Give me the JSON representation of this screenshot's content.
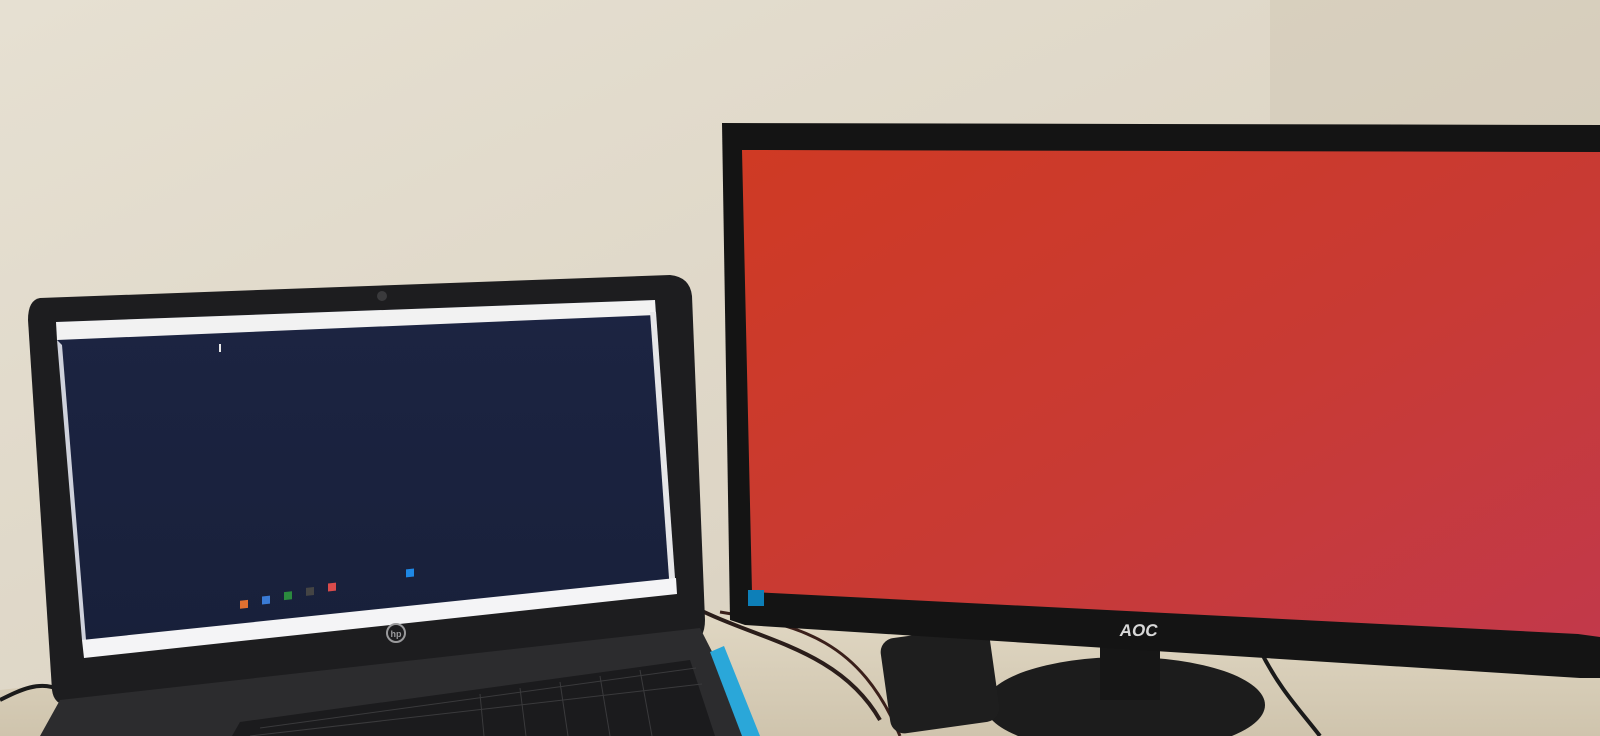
{
  "scene": {
    "wall_color": "#e3dccf",
    "desk_color": "#dcd2bd"
  },
  "laptop": {
    "brand_logo": "hp",
    "screen_background": "#1b2340",
    "window_title_bar": "#f2f2f2",
    "taskbar_color": "#f4f4f6",
    "icons": [
      "webcam-icon",
      "hp-logo-icon"
    ]
  },
  "monitor": {
    "brand_label": "AOC",
    "screen_color": "#c93a30",
    "bezel_color": "#141414",
    "sticker_color": "#0d7fb8"
  }
}
